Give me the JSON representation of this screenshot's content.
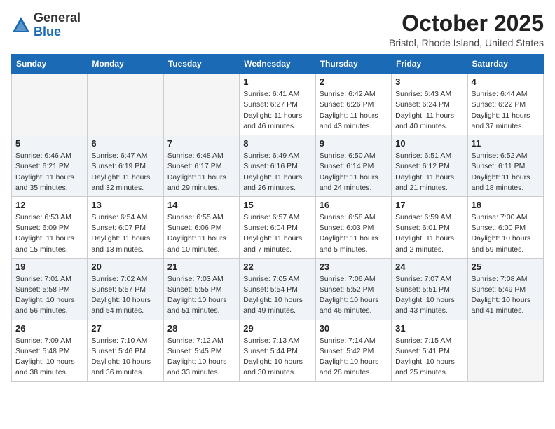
{
  "header": {
    "logo_line1": "General",
    "logo_line2": "Blue",
    "title": "October 2025",
    "subtitle": "Bristol, Rhode Island, United States"
  },
  "columns": [
    "Sunday",
    "Monday",
    "Tuesday",
    "Wednesday",
    "Thursday",
    "Friday",
    "Saturday"
  ],
  "weeks": [
    [
      {
        "day": "",
        "info": ""
      },
      {
        "day": "",
        "info": ""
      },
      {
        "day": "",
        "info": ""
      },
      {
        "day": "1",
        "info": "Sunrise: 6:41 AM\nSunset: 6:27 PM\nDaylight: 11 hours\nand 46 minutes."
      },
      {
        "day": "2",
        "info": "Sunrise: 6:42 AM\nSunset: 6:26 PM\nDaylight: 11 hours\nand 43 minutes."
      },
      {
        "day": "3",
        "info": "Sunrise: 6:43 AM\nSunset: 6:24 PM\nDaylight: 11 hours\nand 40 minutes."
      },
      {
        "day": "4",
        "info": "Sunrise: 6:44 AM\nSunset: 6:22 PM\nDaylight: 11 hours\nand 37 minutes."
      }
    ],
    [
      {
        "day": "5",
        "info": "Sunrise: 6:46 AM\nSunset: 6:21 PM\nDaylight: 11 hours\nand 35 minutes."
      },
      {
        "day": "6",
        "info": "Sunrise: 6:47 AM\nSunset: 6:19 PM\nDaylight: 11 hours\nand 32 minutes."
      },
      {
        "day": "7",
        "info": "Sunrise: 6:48 AM\nSunset: 6:17 PM\nDaylight: 11 hours\nand 29 minutes."
      },
      {
        "day": "8",
        "info": "Sunrise: 6:49 AM\nSunset: 6:16 PM\nDaylight: 11 hours\nand 26 minutes."
      },
      {
        "day": "9",
        "info": "Sunrise: 6:50 AM\nSunset: 6:14 PM\nDaylight: 11 hours\nand 24 minutes."
      },
      {
        "day": "10",
        "info": "Sunrise: 6:51 AM\nSunset: 6:12 PM\nDaylight: 11 hours\nand 21 minutes."
      },
      {
        "day": "11",
        "info": "Sunrise: 6:52 AM\nSunset: 6:11 PM\nDaylight: 11 hours\nand 18 minutes."
      }
    ],
    [
      {
        "day": "12",
        "info": "Sunrise: 6:53 AM\nSunset: 6:09 PM\nDaylight: 11 hours\nand 15 minutes."
      },
      {
        "day": "13",
        "info": "Sunrise: 6:54 AM\nSunset: 6:07 PM\nDaylight: 11 hours\nand 13 minutes."
      },
      {
        "day": "14",
        "info": "Sunrise: 6:55 AM\nSunset: 6:06 PM\nDaylight: 11 hours\nand 10 minutes."
      },
      {
        "day": "15",
        "info": "Sunrise: 6:57 AM\nSunset: 6:04 PM\nDaylight: 11 hours\nand 7 minutes."
      },
      {
        "day": "16",
        "info": "Sunrise: 6:58 AM\nSunset: 6:03 PM\nDaylight: 11 hours\nand 5 minutes."
      },
      {
        "day": "17",
        "info": "Sunrise: 6:59 AM\nSunset: 6:01 PM\nDaylight: 11 hours\nand 2 minutes."
      },
      {
        "day": "18",
        "info": "Sunrise: 7:00 AM\nSunset: 6:00 PM\nDaylight: 10 hours\nand 59 minutes."
      }
    ],
    [
      {
        "day": "19",
        "info": "Sunrise: 7:01 AM\nSunset: 5:58 PM\nDaylight: 10 hours\nand 56 minutes."
      },
      {
        "day": "20",
        "info": "Sunrise: 7:02 AM\nSunset: 5:57 PM\nDaylight: 10 hours\nand 54 minutes."
      },
      {
        "day": "21",
        "info": "Sunrise: 7:03 AM\nSunset: 5:55 PM\nDaylight: 10 hours\nand 51 minutes."
      },
      {
        "day": "22",
        "info": "Sunrise: 7:05 AM\nSunset: 5:54 PM\nDaylight: 10 hours\nand 49 minutes."
      },
      {
        "day": "23",
        "info": "Sunrise: 7:06 AM\nSunset: 5:52 PM\nDaylight: 10 hours\nand 46 minutes."
      },
      {
        "day": "24",
        "info": "Sunrise: 7:07 AM\nSunset: 5:51 PM\nDaylight: 10 hours\nand 43 minutes."
      },
      {
        "day": "25",
        "info": "Sunrise: 7:08 AM\nSunset: 5:49 PM\nDaylight: 10 hours\nand 41 minutes."
      }
    ],
    [
      {
        "day": "26",
        "info": "Sunrise: 7:09 AM\nSunset: 5:48 PM\nDaylight: 10 hours\nand 38 minutes."
      },
      {
        "day": "27",
        "info": "Sunrise: 7:10 AM\nSunset: 5:46 PM\nDaylight: 10 hours\nand 36 minutes."
      },
      {
        "day": "28",
        "info": "Sunrise: 7:12 AM\nSunset: 5:45 PM\nDaylight: 10 hours\nand 33 minutes."
      },
      {
        "day": "29",
        "info": "Sunrise: 7:13 AM\nSunset: 5:44 PM\nDaylight: 10 hours\nand 30 minutes."
      },
      {
        "day": "30",
        "info": "Sunrise: 7:14 AM\nSunset: 5:42 PM\nDaylight: 10 hours\nand 28 minutes."
      },
      {
        "day": "31",
        "info": "Sunrise: 7:15 AM\nSunset: 5:41 PM\nDaylight: 10 hours\nand 25 minutes."
      },
      {
        "day": "",
        "info": ""
      }
    ]
  ]
}
